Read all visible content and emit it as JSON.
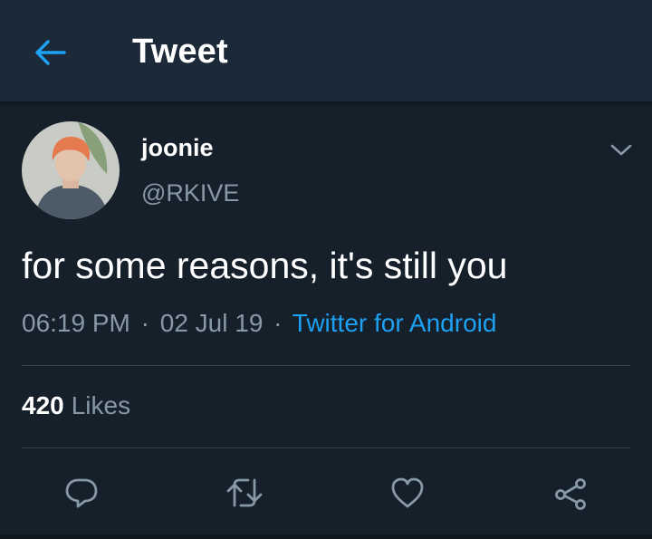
{
  "header": {
    "title": "Tweet",
    "back_icon": "arrow-left-icon"
  },
  "tweet": {
    "display_name": "joonie",
    "handle": "@RKIVE",
    "text": "for some reasons, it's still you",
    "time": "06:19 PM",
    "date": "02 Jul 19",
    "separator": "·",
    "source": "Twitter for Android",
    "likes_count": "420",
    "likes_label": "Likes"
  },
  "actions": [
    "reply-icon",
    "retweet-icon",
    "like-icon",
    "share-icon"
  ],
  "colors": {
    "background": "#15202b",
    "header_bg": "#1c2938",
    "accent": "#1da1f2",
    "secondary_text": "#8899a6",
    "divider": "#38444d"
  }
}
